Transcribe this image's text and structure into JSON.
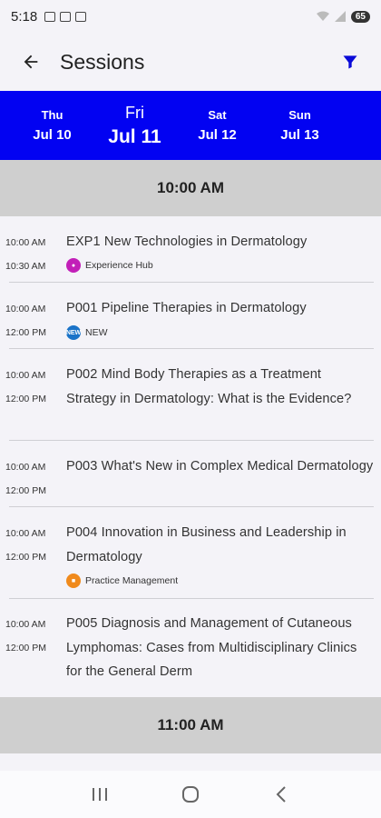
{
  "status": {
    "time": "5:18",
    "battery": "65"
  },
  "app_bar": {
    "title": "Sessions"
  },
  "days": [
    {
      "dow": "Thu",
      "date": "Jul 10"
    },
    {
      "dow": "Fri",
      "date": "Jul 11"
    },
    {
      "dow": "Sat",
      "date": "Jul 12"
    },
    {
      "dow": "Sun",
      "date": "Jul 13"
    }
  ],
  "time_headers": [
    "10:00 AM",
    "11:00 AM"
  ],
  "sessions": [
    {
      "start": "10:00 AM",
      "end": "10:30 AM",
      "title": "EXP1 New Technologies in Dermatology",
      "tag": "Experience Hub",
      "tag_color": "#c21fb8"
    },
    {
      "start": "10:00 AM",
      "end": "12:00 PM",
      "title": "P001 Pipeline Therapies in Dermatology",
      "tag": "NEW",
      "tag_color": "#1a73c8"
    },
    {
      "start": "10:00 AM",
      "end": "12:00 PM",
      "title": "P002 Mind Body Therapies as a Treatment Strategy in Dermatology: What is the Evidence?"
    },
    {
      "start": "10:00 AM",
      "end": "12:00 PM",
      "title": "P003 What's New in Complex Medical Dermatology"
    },
    {
      "start": "10:00 AM",
      "end": "12:00 PM",
      "title": "P004 Innovation in Business and Leadership in Dermatology",
      "tag": "Practice Management",
      "tag_color": "#f08a1c"
    },
    {
      "start": "10:00 AM",
      "end": "12:00 PM",
      "title": "P005 Diagnosis and Management of Cutaneous Lymphomas: Cases from Multidisciplinary Clinics for the General Derm"
    }
  ],
  "colors": {
    "tab_bar": "#0202f2",
    "filter_icon": "#0a0ad8",
    "time_header_bg": "#cfcfcf"
  }
}
